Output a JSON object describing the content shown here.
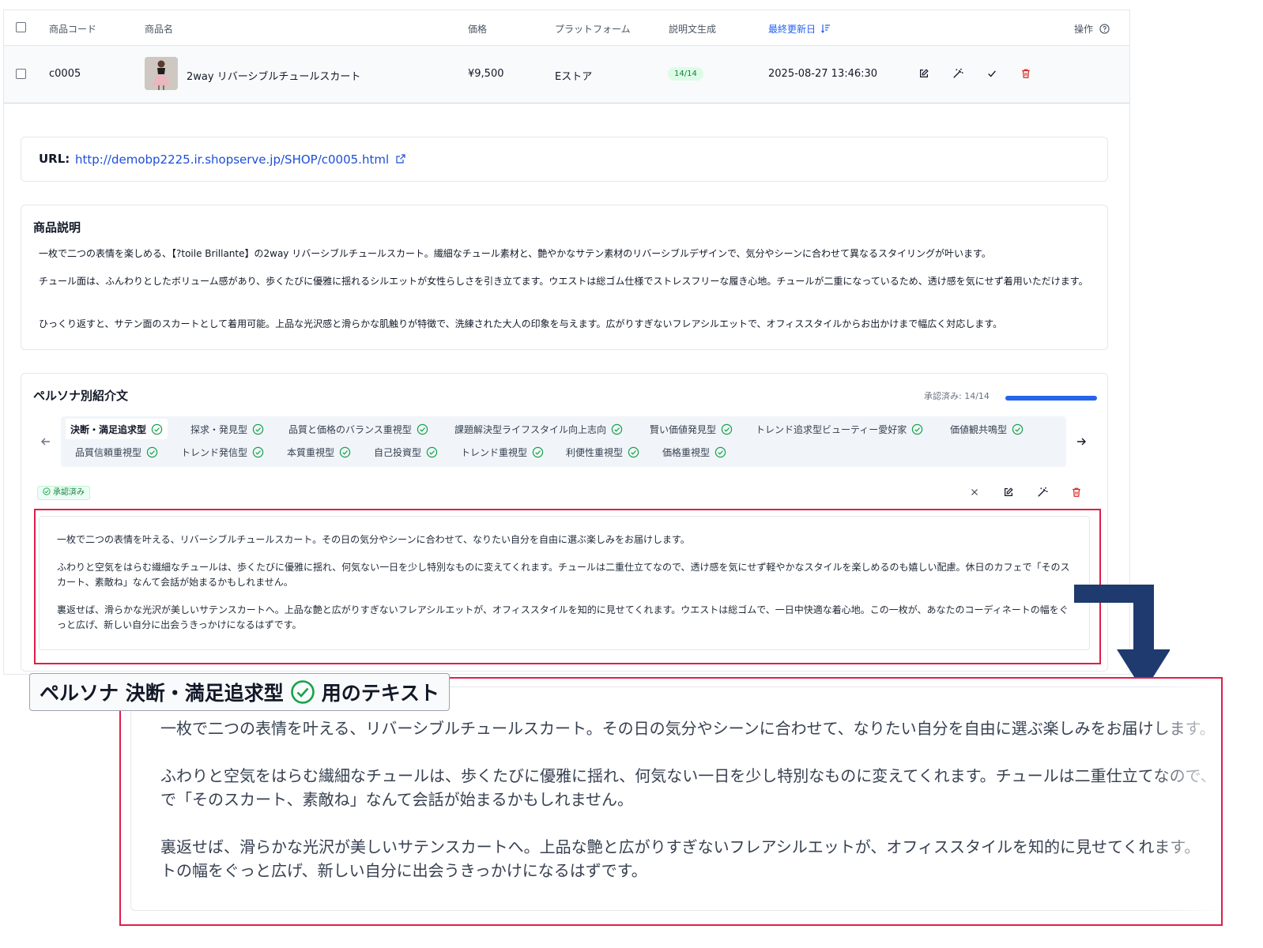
{
  "table": {
    "headers": {
      "code": "商品コード",
      "name": "商品名",
      "price": "価格",
      "platform": "プラットフォーム",
      "desc_gen": "説明文生成",
      "updated": "最終更新日",
      "actions": "操作"
    },
    "row": {
      "code": "c0005",
      "name": "2way リバーシブルチュールスカート",
      "price": "¥9,500",
      "platform": "Eストア",
      "desc_gen_badge": "14/14",
      "updated": "2025-08-27 13:46:30"
    }
  },
  "url_section": {
    "label": "URL:",
    "link": "http://demobp2225.ir.shopserve.jp/SHOP/c0005.html"
  },
  "description": {
    "title": "商品説明",
    "p1": "一枚で二つの表情を楽しめる、【?toile Brillante】の2way リバーシブルチュールスカート。繊細なチュール素材と、艶やかなサテン素材のリバーシブルデザインで、気分やシーンに合わせて異なるスタイリングが叶います。",
    "p2": "チュール面は、ふんわりとしたボリューム感があり、歩くたびに優雅に揺れるシルエットが女性らしさを引き立てます。ウエストは総ゴム仕様でストレスフリーな履き心地。チュールが二重になっているため、透け感を気にせず着用いただけます。",
    "p3": "ひっくり返すと、サテン面のスカートとして着用可能。上品な光沢感と滑らかな肌触りが特徴で、洗練された大人の印象を与えます。広がりすぎないフレアシルエットで、オフィススタイルからお出かけまで幅広く対応します。"
  },
  "persona": {
    "title": "ペルソナ別紹介文",
    "progress_label": "承認済み: 14/14",
    "progress_fraction": 1.0,
    "tabs_row1": [
      "決断・満足追求型",
      "探求・発見型",
      "品質と価格のバランス重視型",
      "課題解決型ライフスタイル向上志向",
      "賢い価値発見型",
      "トレンド追求型ビューティー愛好家",
      "価値観共鳴型"
    ],
    "tabs_row2": [
      "品質信頼重視型",
      "トレンド発信型",
      "本質重視型",
      "自己投資型",
      "トレンド重視型",
      "利便性重視型",
      "価格重視型"
    ],
    "approved_badge": "承認済み",
    "text_p1": "一枚で二つの表情を叶える、リバーシブルチュールスカート。その日の気分やシーンに合わせて、なりたい自分を自由に選ぶ楽しみをお届けします。",
    "text_p2": "ふわりと空気をはらむ繊細なチュールは、歩くたびに優雅に揺れ、何気ない一日を少し特別なものに変えてくれます。チュールは二重仕立てなので、透け感を気にせず軽やかなスタイルを楽しめるのも嬉しい配慮。休日のカフェで「そのスカート、素敵ね」なんて会話が始まるかもしれません。",
    "text_p3": "裏返せば、滑らかな光沢が美しいサテンスカートへ。上品な艶と広がりすぎないフレアシルエットが、オフィススタイルを知的に見せてくれます。ウエストは総ゴムで、一日中快適な着心地。この一枚が、あなたのコーディネートの幅をぐっと広げ、新しい自分に出会うきっかけになるはずです。"
  },
  "zoom": {
    "callout_prefix": "ペルソナ 決断・満足追求型",
    "callout_suffix": "用のテキスト",
    "l1": "一枚で二つの表情を叶える、リバーシブルチュールスカート。その日の気分やシーンに合わせて、なりたい自分を自由に選ぶ楽しみをお届けします。",
    "l2": "ふわりと空気をはらむ繊細なチュールは、歩くたびに優雅に揺れ、何気ない一日を少し特別なものに変えてくれます。チュールは二重仕立てなので、",
    "l3": "で「そのスカート、素敵ね」なんて会話が始まるかもしれません。",
    "l4": "裏返せば、滑らかな光沢が美しいサテンスカートへ。上品な艶と広がりすぎないフレアシルエットが、オフィススタイルを知的に見せてくれます。",
    "l5": "トの幅をぐっと広げ、新しい自分に出会うきっかけになるはずです。"
  },
  "colors": {
    "accent_blue": "#2563eb",
    "approve_green": "#16a34a",
    "delete_red": "#dc2626",
    "highlight_red": "#e11d48",
    "arrow_navy": "#1e3a6e"
  },
  "icons": [
    "sort-icon",
    "help-icon",
    "edit-icon",
    "magic-wand-icon",
    "check-icon",
    "trash-icon",
    "external-link-icon",
    "arrow-left-icon",
    "arrow-right-icon",
    "check-circle-icon",
    "close-icon"
  ]
}
